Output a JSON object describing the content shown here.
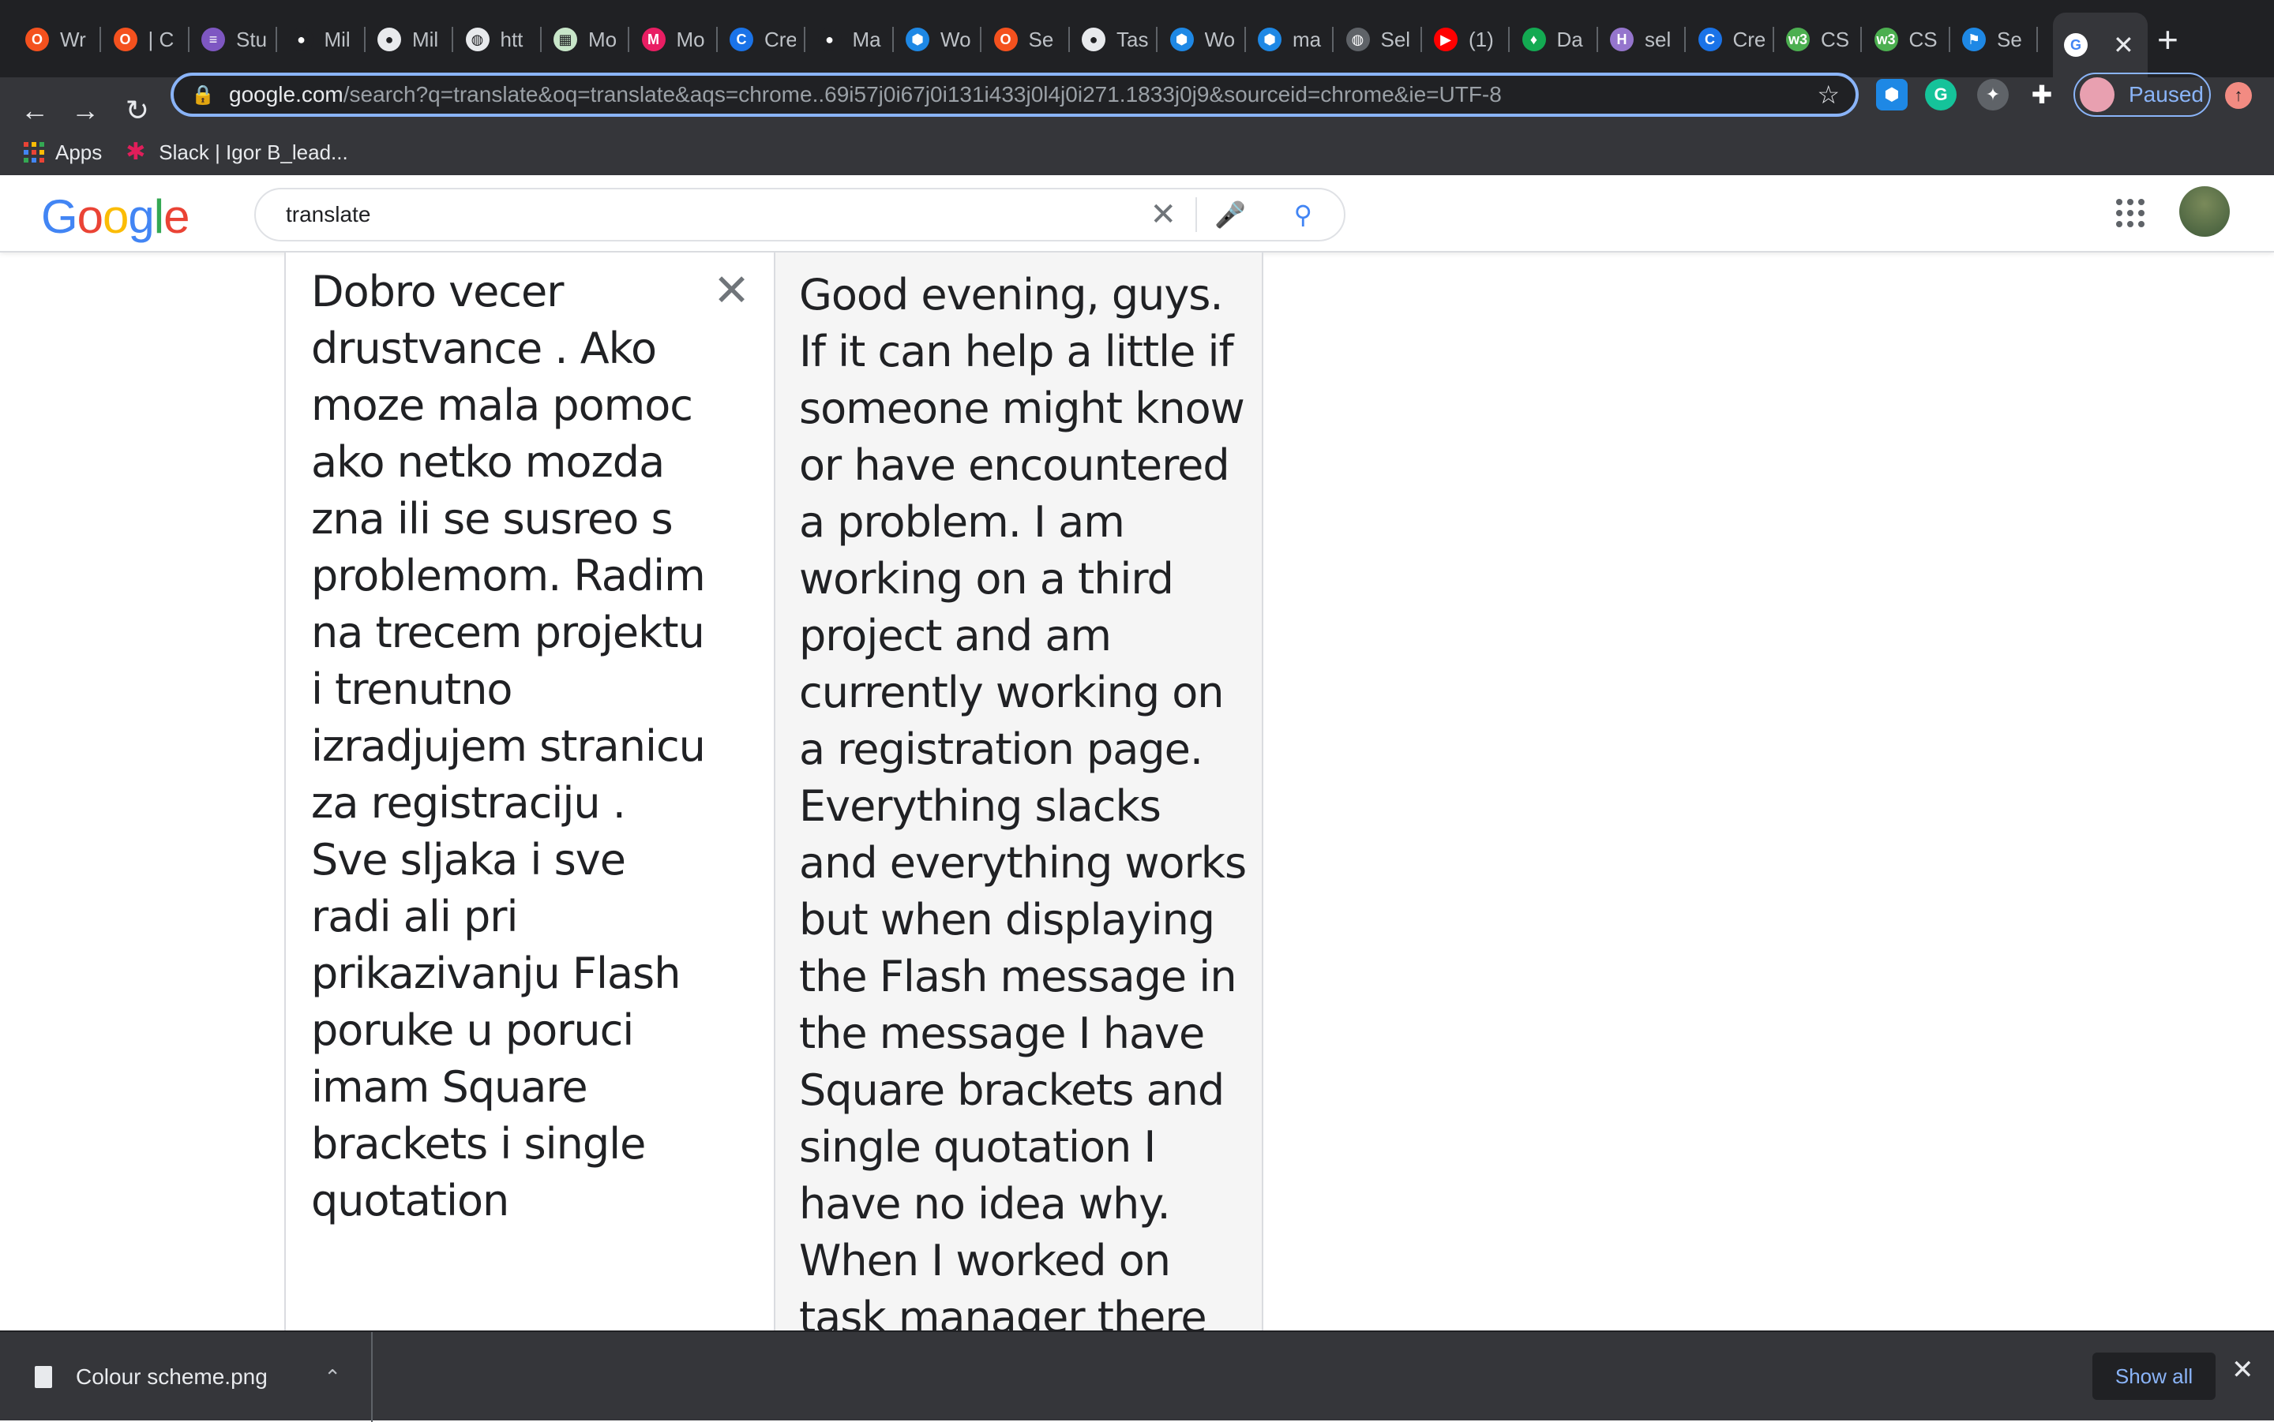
{
  "browser": {
    "tabs": [
      {
        "title": "Wr",
        "icon": "opera-icon",
        "color": "#f4511e"
      },
      {
        "title": "| C",
        "icon": "opera-icon",
        "color": "#f4511e"
      },
      {
        "title": "Stu",
        "icon": "list-icon",
        "color": "#7e57c2"
      },
      {
        "title": "Mil",
        "icon": "github-icon",
        "color": "#202124"
      },
      {
        "title": "Mil",
        "icon": "github-icon",
        "color": "#e8eaed"
      },
      {
        "title": "htt",
        "icon": "globe-icon",
        "color": "#e8eaed"
      },
      {
        "title": "Mo",
        "icon": "sheet-icon",
        "color": "#c8e6c9"
      },
      {
        "title": "Mo",
        "icon": "m-icon",
        "color": "#e91e63"
      },
      {
        "title": "Cre",
        "icon": "c-icon",
        "color": "#1a73e8"
      },
      {
        "title": "Ma",
        "icon": "github-icon",
        "color": "#202124"
      },
      {
        "title": "Wo",
        "icon": "cube-icon",
        "color": "#1e88e5"
      },
      {
        "title": "Se",
        "icon": "opera-icon",
        "color": "#f4511e"
      },
      {
        "title": "Tas",
        "icon": "github-icon",
        "color": "#e8eaed"
      },
      {
        "title": "Wo",
        "icon": "cube-icon",
        "color": "#1e88e5"
      },
      {
        "title": "ma",
        "icon": "cube-icon",
        "color": "#1e88e5"
      },
      {
        "title": "Sel",
        "icon": "globe-icon",
        "color": "#5f6368"
      },
      {
        "title": "(1)",
        "icon": "youtube-icon",
        "color": "#ff0000"
      },
      {
        "title": "Da",
        "icon": "leaf-icon",
        "color": "#13aa52"
      },
      {
        "title": "sel",
        "icon": "h-icon",
        "color": "#9575cd"
      },
      {
        "title": "Cre",
        "icon": "c-icon",
        "color": "#1a73e8"
      },
      {
        "title": "CS",
        "icon": "w3-icon",
        "color": "#4caf50"
      },
      {
        "title": "CS",
        "icon": "w3-icon",
        "color": "#4caf50"
      },
      {
        "title": "Se",
        "icon": "flag-icon",
        "color": "#1e88e5"
      }
    ],
    "active_tab_icon": "google-icon",
    "url_host": "google.com",
    "url_path": "/search?q=translate&oq=translate&aqs=chrome..69i57j0i67j0i131i433j0l4j0i271.1833j0j9&sourceid=chrome&ie=UTF-8",
    "profile_label": "Paused",
    "bookmarks": [
      {
        "label": "Apps"
      },
      {
        "label": "Slack | Igor B_lead..."
      }
    ]
  },
  "google": {
    "logo": "Google",
    "query": "translate"
  },
  "translate": {
    "source_text": "Dobro vecer drustvance . Ako moze mala pomoc ako netko mozda zna ili se susreo s problemom. Radim na trecem projektu i trenutno izradjujem stranicu za registraciju . Sve sljaka i sve radi ali pri prikazivanju Flash poruke u poruci imam Square brackets i single quotation",
    "target_text": "Good evening, guys. If it can help a little if someone might know or have encountered a problem. I am working on a third project and am currently working on a registration page. Everything slacks and everything works but when displaying the Flash message in the message I have Square brackets and single quotation I have no idea why. When I worked on task manager there"
  },
  "downloads": {
    "file_name": "Colour scheme.png",
    "show_all": "Show all"
  }
}
